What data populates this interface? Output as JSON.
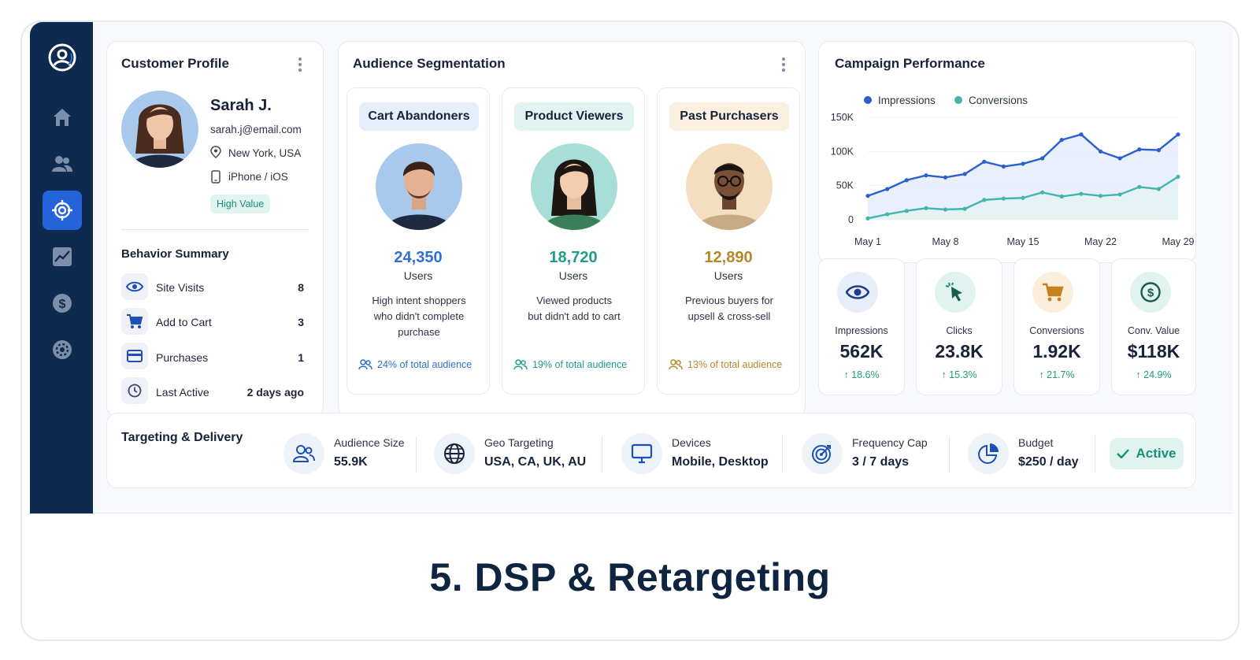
{
  "sidebar": {
    "items": [
      {
        "icon": "home-icon"
      },
      {
        "icon": "users-icon"
      },
      {
        "icon": "target-icon",
        "active": true
      },
      {
        "icon": "analytics-icon"
      },
      {
        "icon": "dollar-icon"
      },
      {
        "icon": "settings-icon"
      }
    ]
  },
  "profile": {
    "title": "Customer Profile",
    "name": "Sarah J.",
    "email": "sarah.j@email.com",
    "location": "New York, USA",
    "device": "iPhone / iOS",
    "badge": "High Value",
    "behavior_title": "Behavior Summary",
    "behavior": [
      {
        "label": "Site Visits",
        "value": "8",
        "icon": "eye-icon"
      },
      {
        "label": "Add to Cart",
        "value": "3",
        "icon": "cart-icon"
      },
      {
        "label": "Purchases",
        "value": "1",
        "icon": "credit-card-icon"
      },
      {
        "label": "Last Active",
        "value": "2 days ago",
        "icon": "clock-icon"
      }
    ]
  },
  "segmentation": {
    "title": "Audience Segmentation",
    "segments": [
      {
        "name": "Cart Abandoners",
        "count": "24,350",
        "unit": "Users",
        "desc": [
          "High intent shoppers",
          "who didn't complete",
          "purchase"
        ],
        "share": "24% of total audience",
        "color": "#2f6fd6",
        "pill_bg": "#e6eefb"
      },
      {
        "name": "Product Viewers",
        "count": "18,720",
        "unit": "Users",
        "desc": [
          "Viewed products",
          "but didn't add to cart"
        ],
        "share": "19% of total audience",
        "color": "#1e9c8e",
        "pill_bg": "#e1f3f0"
      },
      {
        "name": "Past Purchasers",
        "count": "12,890",
        "unit": "Users",
        "desc": [
          "Previous buyers for",
          "upsell & cross-sell"
        ],
        "share": "13% of total audience",
        "color": "#b8862a",
        "pill_bg": "#fbf0df"
      }
    ]
  },
  "campaign": {
    "title": "Campaign Performance"
  },
  "chart_data": {
    "type": "area",
    "x": [
      "May 1",
      "May 3",
      "May 5",
      "May 7",
      "May 8",
      "May 10",
      "May 12",
      "May 14",
      "May 15",
      "May 17",
      "May 19",
      "May 21",
      "May 22",
      "May 24",
      "May 26",
      "May 28",
      "May 29"
    ],
    "xticks": [
      "May 1",
      "May 8",
      "May 15",
      "May 22",
      "May 29"
    ],
    "yticks": [
      "150K",
      "100K",
      "50K",
      "0"
    ],
    "ylim": [
      0,
      150000
    ],
    "legend": "top-left",
    "series": [
      {
        "name": "Impressions",
        "color": "#2b5fce",
        "values": [
          35000,
          45000,
          58000,
          65000,
          62000,
          67000,
          85000,
          78000,
          82000,
          90000,
          117000,
          125000,
          100000,
          90000,
          103000,
          102000,
          125000
        ]
      },
      {
        "name": "Conversions",
        "color": "#44b5ad",
        "values": [
          2000,
          8000,
          13000,
          17000,
          15000,
          16000,
          29000,
          31000,
          32000,
          40000,
          34000,
          38000,
          35000,
          37000,
          48000,
          45000,
          63000
        ]
      }
    ]
  },
  "metrics": [
    {
      "label": "Impressions",
      "value": "562K",
      "delta": "18.6%",
      "icon": "eye-icon",
      "bg": "#e7eefa",
      "fg": "#1d4fb8"
    },
    {
      "label": "Clicks",
      "value": "23.8K",
      "delta": "15.3%",
      "icon": "cursor-click-icon",
      "bg": "#e1f3ef",
      "fg": "#1a8f78"
    },
    {
      "label": "Conversions",
      "value": "1.92K",
      "delta": "21.7%",
      "icon": "cart-icon",
      "bg": "#fbeedb",
      "fg": "#c77f1f"
    },
    {
      "label": "Conv. Value",
      "value": "$118K",
      "delta": "24.9%",
      "icon": "dollar-circle-icon",
      "bg": "#e1f3ef",
      "fg": "#1a8f78"
    }
  ],
  "targeting": {
    "title": "Targeting & Delivery",
    "items": [
      {
        "label": "Audience Size",
        "value": "55.9K",
        "icon": "users-icon"
      },
      {
        "label": "Geo Targeting",
        "value": "USA, CA, UK, AU",
        "icon": "globe-icon"
      },
      {
        "label": "Devices",
        "value": "Mobile, Desktop",
        "icon": "monitor-icon"
      },
      {
        "label": "Frequency Cap",
        "value": "3 / 7 days",
        "icon": "target-icon"
      },
      {
        "label": "Budget",
        "value": "$250 / day",
        "icon": "pie-chart-icon"
      }
    ],
    "status": "Active",
    "status_color": "#1a8f78"
  },
  "caption": "5.  DSP & Retargeting"
}
